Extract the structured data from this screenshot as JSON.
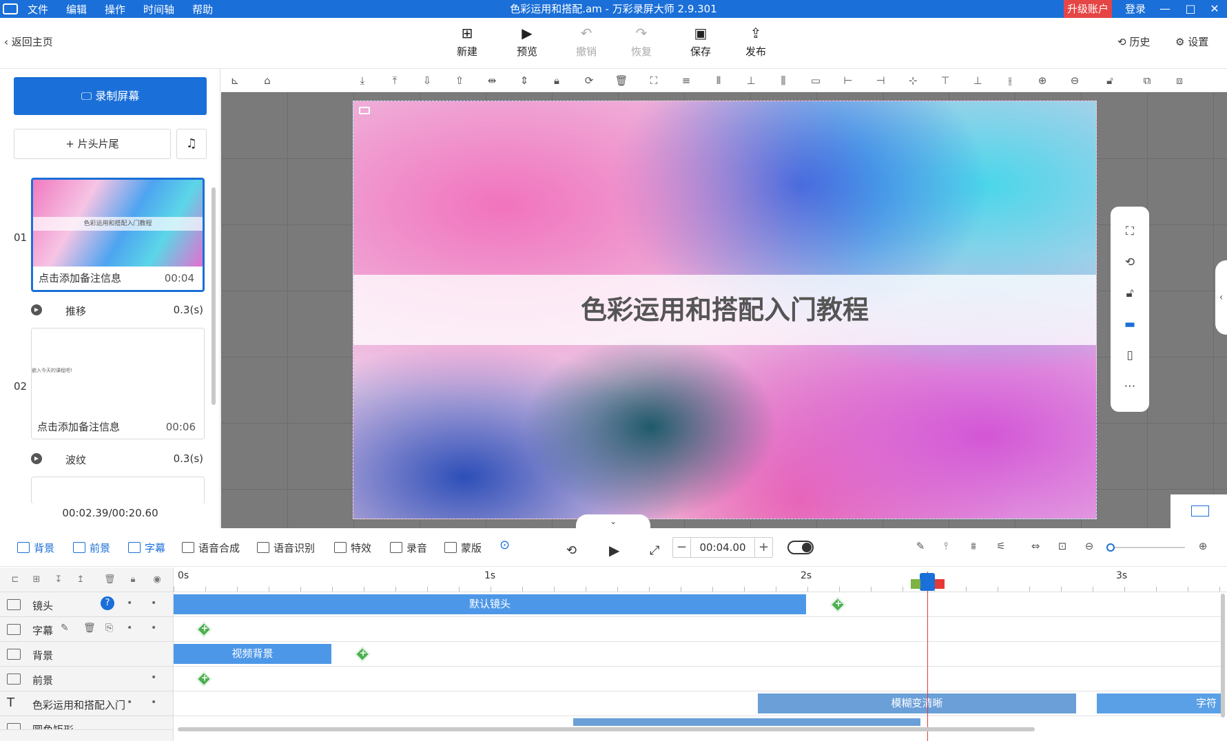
{
  "titlebar": {
    "menu": [
      "文件",
      "编辑",
      "操作",
      "时间轴",
      "帮助"
    ],
    "title": "色彩运用和搭配.am - 万彩录屏大师 2.9.301",
    "upgrade": "升级账户",
    "login": "登录",
    "minimize": "—",
    "maximize": "□",
    "close": "✕"
  },
  "toolbar": {
    "back": "返回主页",
    "new": "新建",
    "preview": "预览",
    "undo": "撤销",
    "redo": "恢复",
    "save": "保存",
    "publish": "发布",
    "history": "历史",
    "settings": "设置"
  },
  "left": {
    "record": "录制屏幕",
    "add_intro": "片头片尾",
    "scenes": [
      {
        "num": "01",
        "caption": "色彩运用和搭配入门教程",
        "note": "点击添加备注信息",
        "duration": "00:04"
      },
      {
        "num": "02",
        "caption": "嵌入今天的课程吧!",
        "note": "点击添加备注信息",
        "duration": "00:06"
      }
    ],
    "transitions": [
      {
        "name": "推移",
        "time": "0.3(s)"
      },
      {
        "name": "波纹",
        "time": "0.3(s)"
      }
    ],
    "time_position": "00:02.39/00:20.60"
  },
  "stage": {
    "headline": "色彩运用和搭配入门教程"
  },
  "timeline_bar": {
    "tabs": [
      "背景",
      "前景",
      "字幕",
      "语音合成",
      "语音识别",
      "特效",
      "录音",
      "蒙版"
    ],
    "time": "00:04.00"
  },
  "ruler": [
    "0s",
    "1s",
    "2s",
    "3s"
  ],
  "tracks": [
    {
      "label": "镜头"
    },
    {
      "label": "字幕"
    },
    {
      "label": "背景"
    },
    {
      "label": "前景"
    },
    {
      "label": "色彩运用和搭配入门"
    },
    {
      "label": "圆角矩形"
    }
  ],
  "clips": {
    "camera": "默认镜头",
    "background": "视频背景",
    "effect": "模糊变清晰",
    "subtitle_partial": "字符"
  },
  "colors": {
    "accent": "#1a6fd8",
    "upgrade": "#e54545",
    "keyframe": "#4caf50",
    "playhead": "#e53935"
  }
}
